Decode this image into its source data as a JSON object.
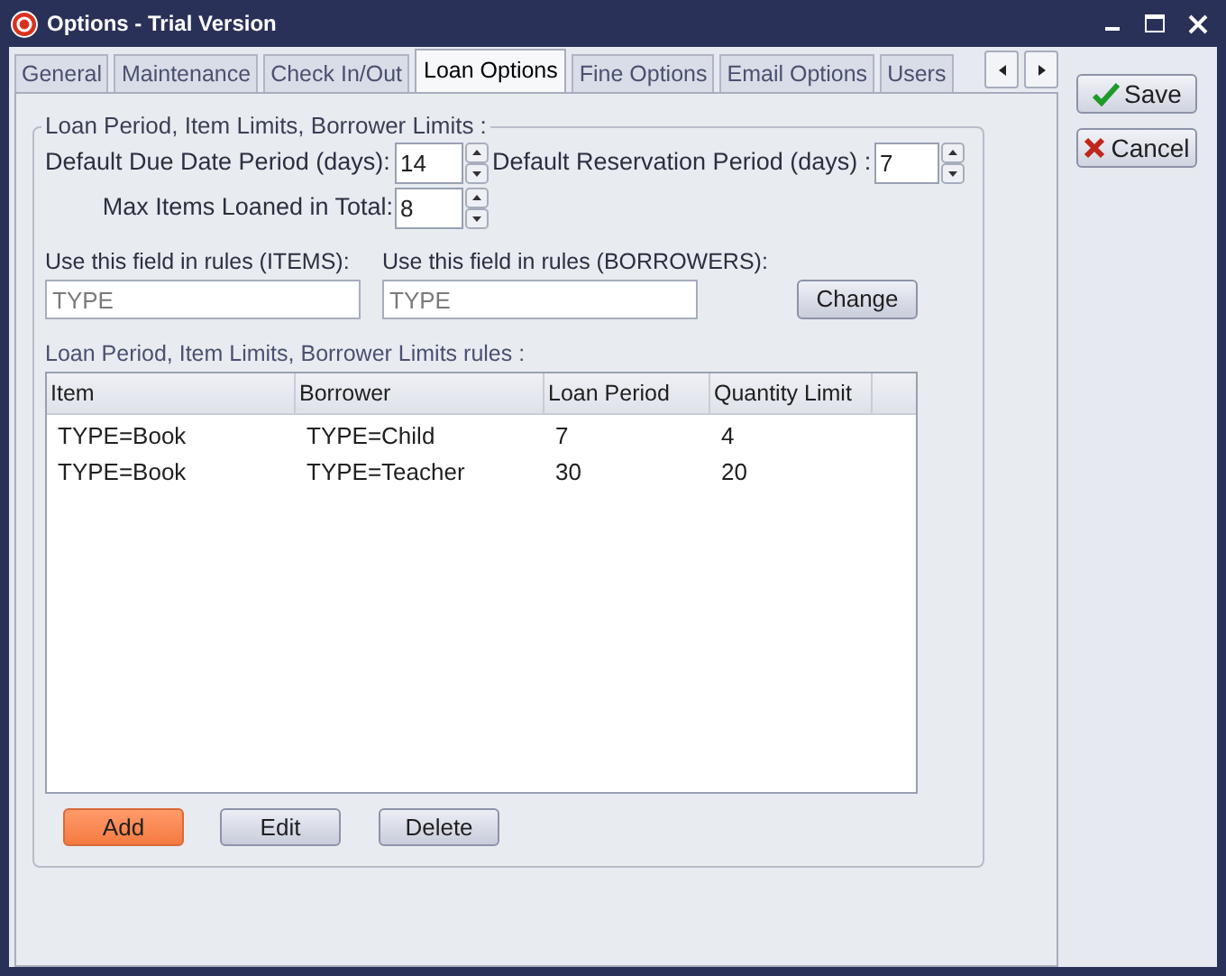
{
  "window": {
    "title": "Options - Trial Version"
  },
  "tabs": [
    {
      "label": "General",
      "selected": false
    },
    {
      "label": "Maintenance",
      "selected": false
    },
    {
      "label": "Check In/Out",
      "selected": false
    },
    {
      "label": "Loan Options",
      "selected": true
    },
    {
      "label": "Fine Options",
      "selected": false
    },
    {
      "label": "Email Options",
      "selected": false
    },
    {
      "label": "Users",
      "selected": false
    }
  ],
  "group": {
    "legend": "Loan Period, Item Limits, Borrower Limits :",
    "due_date": {
      "label": "Default Due Date Period (days):",
      "value": "14"
    },
    "reservation": {
      "label": "Default Reservation Period (days) :",
      "value": "7"
    },
    "max_items": {
      "label": "Max Items Loaned in Total:",
      "value": "8"
    },
    "items_field": {
      "label": "Use this field in rules (ITEMS):",
      "value": "TYPE",
      "disabled": true
    },
    "borrowers_field": {
      "label": "Use this field in rules (BORROWERS):",
      "value": "TYPE",
      "disabled": true
    },
    "change_button": "Change",
    "rules_label": "Loan Period, Item Limits, Borrower Limits rules :",
    "table": {
      "columns": [
        "Item",
        "Borrower",
        "Loan Period",
        "Quantity Limit"
      ],
      "rows": [
        [
          "TYPE=Book",
          "TYPE=Child",
          "7",
          "4"
        ],
        [
          "TYPE=Book",
          "TYPE=Teacher",
          "30",
          "20"
        ]
      ]
    },
    "buttons": [
      {
        "label": "Add",
        "highlighted": true
      },
      {
        "label": "Edit",
        "highlighted": false
      },
      {
        "label": "Delete",
        "highlighted": false
      }
    ]
  },
  "side_buttons": [
    {
      "label": "Save",
      "kind": "save"
    },
    {
      "label": "Cancel",
      "kind": "cancel"
    }
  ]
}
